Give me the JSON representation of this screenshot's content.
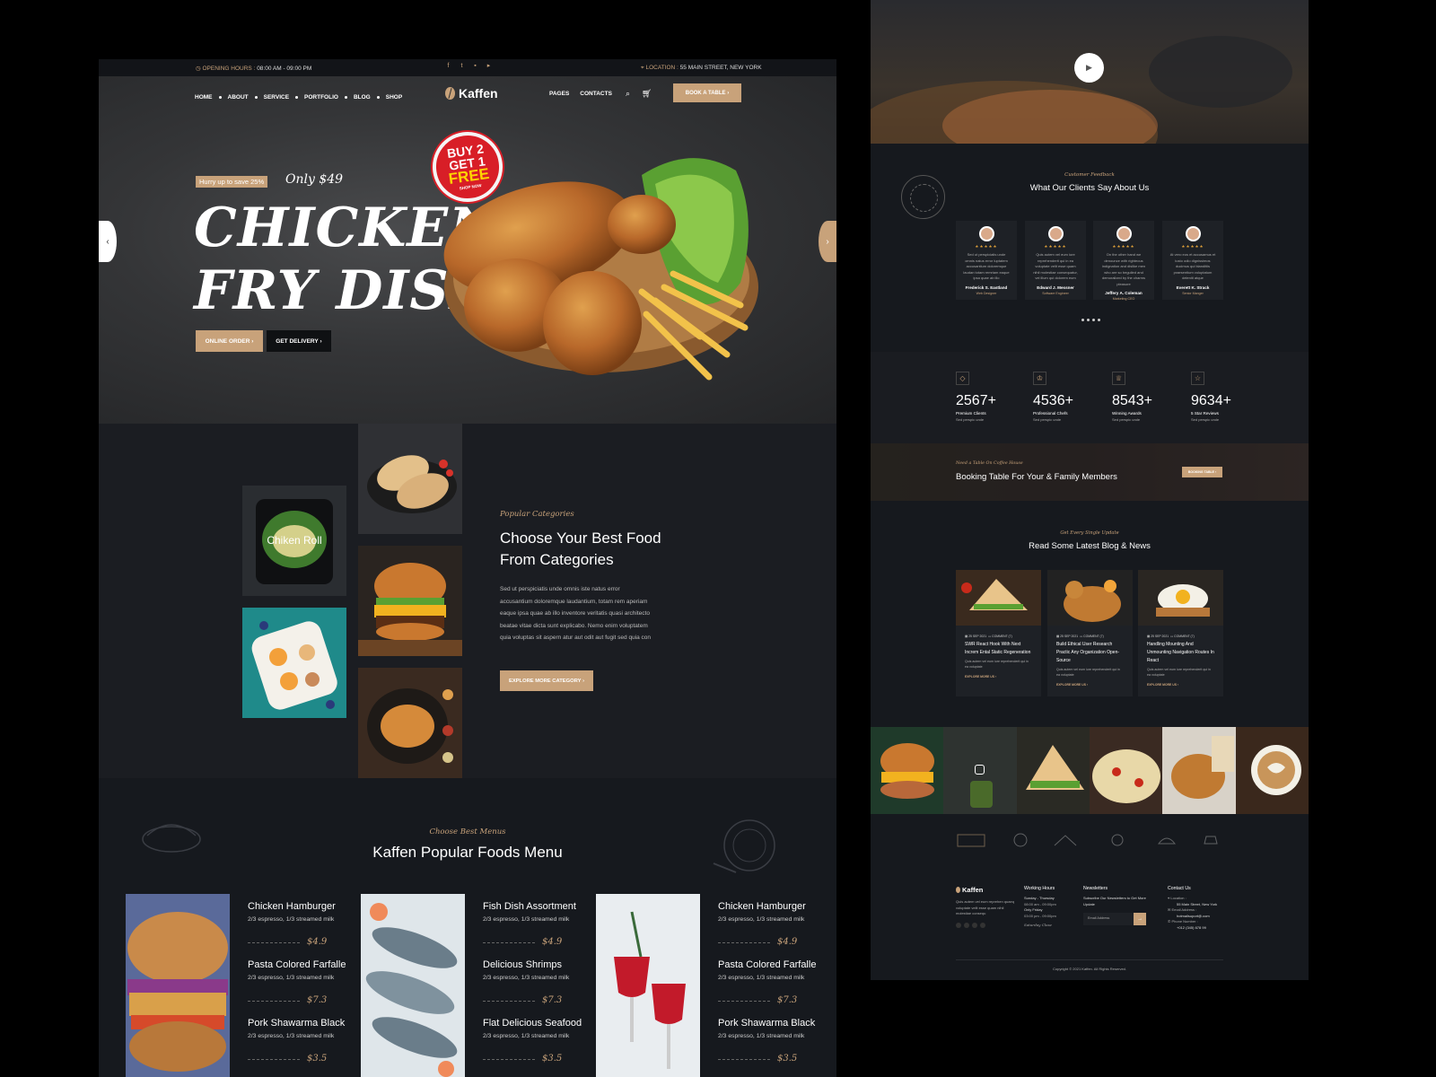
{
  "topbar": {
    "opening_label": "OPENING",
    "hours_label": "HOURS :",
    "hours_value": "08:00 AM - 09:00 PM",
    "location_label": "LOCATION :",
    "location_value": "55 MAIN STREET, NEW YORK",
    "social": [
      "f",
      "t",
      "in",
      "yt"
    ]
  },
  "nav": {
    "left": [
      "HOME",
      "ABOUT",
      "SERVICE",
      "PORTFOLIO",
      "BLOG",
      "SHOP"
    ],
    "brand": "Kaffen",
    "right": [
      "PAGES",
      "CONTACTS"
    ],
    "book_button": "BOOK A TABLE"
  },
  "hero": {
    "badge": "Hurry up to save 25%",
    "price": "Only $49",
    "title_line1": "CHICKEN",
    "title_line2": "FRY DISH",
    "order_button": "ONLINE ORDER",
    "delivery_button": "GET DELIVERY",
    "promo_line1": "BUY 2",
    "promo_line2": "GET 1",
    "promo_line3": "FREE",
    "promo_line4": "SHOP NOW"
  },
  "categories": {
    "card_label": "Chiken Roll",
    "subtitle": "Popular Categories",
    "title_line1": "Choose Your Best Food",
    "title_line2": "From Categories",
    "text": "Sed ut perspiciatis unde omnis iste natus error accusantium doloremque laudantium, totam rem aperiam eaque ipsa quae ab illo inventore veritatis quasi architecto beatae vitae dicta sunt explicabo. Nemo enim voluptatem quia voluptas sit aspern atur aut odit aut fugit sed quia con",
    "button": "EXPLORE MORE CATEGORY"
  },
  "menu": {
    "subtitle": "Choose Best Menus",
    "title": "Kaffen Popular Foods Menu",
    "columns": [
      [
        {
          "name": "Chicken Hamburger",
          "desc": "2/3 espresso, 1/3 streamed milk",
          "price": "$4.9"
        },
        {
          "name": "Pasta Colored Farfalle",
          "desc": "2/3 espresso, 1/3 streamed milk",
          "price": "$7.3"
        },
        {
          "name": "Pork Shawarma Black",
          "desc": "2/3 espresso, 1/3 streamed milk",
          "price": "$3.5"
        }
      ],
      [
        {
          "name": "Fish Dish Assortment",
          "desc": "2/3 espresso, 1/3 streamed milk",
          "price": "$4.9"
        },
        {
          "name": "Delicious Shrimps",
          "desc": "2/3 espresso, 1/3 streamed milk",
          "price": "$7.3"
        },
        {
          "name": "Flat Delicious Seafood",
          "desc": "2/3 espresso, 1/3 streamed milk",
          "price": "$3.5"
        }
      ],
      [
        {
          "name": "Chicken Hamburger",
          "desc": "2/3 espresso, 1/3 streamed milk",
          "price": "$4.9"
        },
        {
          "name": "Pasta Colored Farfalle",
          "desc": "2/3 espresso, 1/3 streamed milk",
          "price": "$7.3"
        },
        {
          "name": "Pork Shawarma Black",
          "desc": "2/3 espresso, 1/3 streamed milk",
          "price": "$3.5"
        }
      ]
    ]
  },
  "testimonials": {
    "subtitle": "Customer Feedback",
    "title": "What Our Clients Say About Us",
    "stars": "★★★★★",
    "items": [
      {
        "text": "Sed ut perspiciatis unde omnis natus error luptatem accusantium doloremque laudan totam remriam eaque ipsa quae ab illo",
        "name": "Frederick S. Eastland",
        "role": "Web Designer"
      },
      {
        "text": "Quis autem vel eum iure reprehenderit qui in ea voluptate velit esse quam nihil molestiae consequatur, vel illum qui dolorem eum",
        "name": "Edward J. Messner",
        "role": "Software Engineer"
      },
      {
        "text": "On the other hand we denounce with righteous indignation and dislike men who are so beguiled and demoralized by the charms pleasure",
        "name": "Jeffery A. Coleman",
        "role": "Marketing CEO"
      },
      {
        "text": "At vero eos et accusamus et iusto odio dignissimos ducimus qui blanditiis praesentium voluptatum deleniti atque",
        "name": "Everett K. Strack",
        "role": "Senior Manger"
      }
    ]
  },
  "stats": [
    {
      "num": "2567+",
      "label": "Premium Clients",
      "sub": "Sed perspic unde"
    },
    {
      "num": "4536+",
      "label": "Professional Chefs",
      "sub": "Sed perspic unde"
    },
    {
      "num": "8543+",
      "label": "Winning Awards",
      "sub": "Sed perspic unde"
    },
    {
      "num": "9634+",
      "label": "5 Star Reviews",
      "sub": "Sed perspic unde"
    }
  ],
  "booking": {
    "subtitle": "Need a Table On Coffee House",
    "title": "Booking Table For Your & Family Members",
    "button": "BOOKING TABLE"
  },
  "blog": {
    "subtitle": "Get Every Single Update",
    "title": "Read Some Latest Blog & News",
    "items": [
      {
        "date": "25 SEP 2021",
        "comment": "COMMENT (7)",
        "title": "SWR React Hook With Next Increm Ental Static Regeneration",
        "text": "Quis autem vel eum iure reprehenderit qui in ea voluptate",
        "more": "EXPLORE MORE US"
      },
      {
        "date": "25 SEP 2021",
        "comment": "COMMENT (7)",
        "title": "Build Ethical User Research Practic Any Organization Open-Source",
        "text": "Quis autem vel eum iure reprehenderit qui in ea voluptate",
        "more": "EXPLORE MORE US"
      },
      {
        "date": "25 SEP 2021",
        "comment": "COMMENT (7)",
        "title": "Handling Mounting And Unmounting Navigation Routes In React",
        "text": "Quis autem vel eum iure reprehenderit qui in ea voluptate",
        "more": "EXPLORE MORE US"
      }
    ]
  },
  "footer": {
    "brand": "Kaffen",
    "about": "Quis autem vel eum reprehen quaeq voluptate velit esse quam nihil molestiae consequ",
    "hours_head": "Working Hours",
    "hours_1": "Sunday - Thursday",
    "hours_1v": "08:00 am - 09:00pm",
    "hours_2": "Only Friday",
    "hours_2v": "03:00 pm - 09:00pm",
    "hours_closed": "Saturday Close",
    "news_head": "Newsletters",
    "news_text": "Subscribe Our Newsletters to Get More Update",
    "email_placeholder": "Email Address",
    "contact_head": "Contact Us",
    "loc_label": "Location :",
    "loc_value": "55 Main Street, New York",
    "email_label": "Email Address :",
    "email_value": "hotmailsuport@.com",
    "phone_label": "Phone Number :",
    "phone_value": "+012 (345) 678 99",
    "copyright": "Copyright © 2021 Kaffen. All Rights Reserved."
  }
}
